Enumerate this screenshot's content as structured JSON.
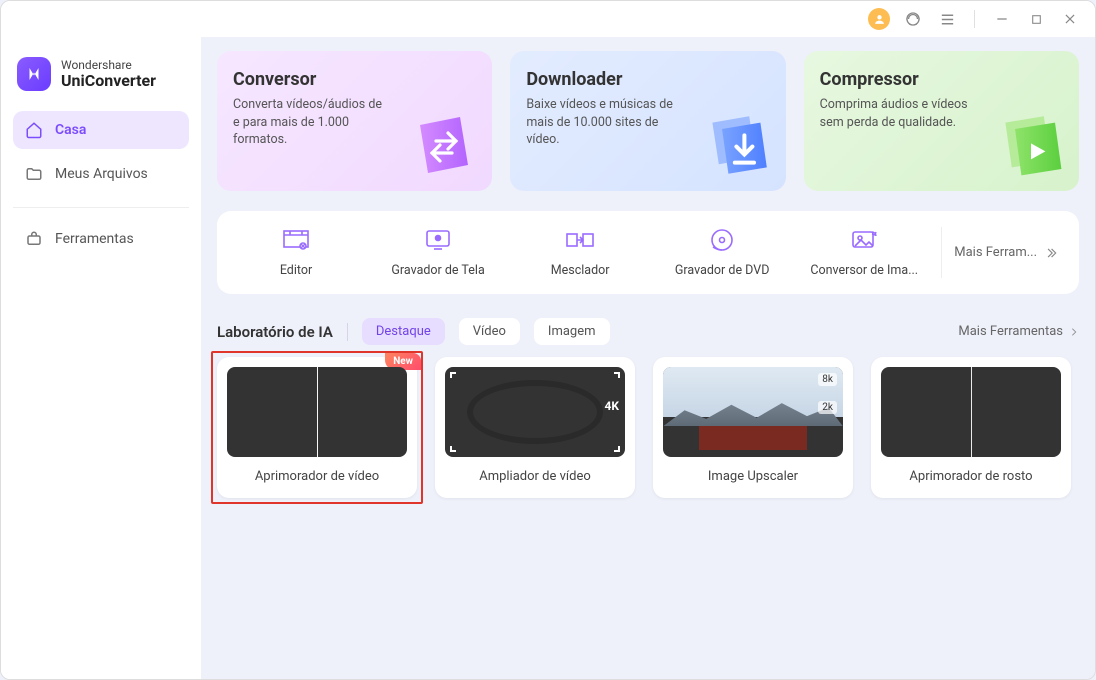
{
  "app": {
    "brand_small": "Wondershare",
    "brand_big": "UniConverter"
  },
  "sidebar": {
    "items": [
      {
        "label": "Casa"
      },
      {
        "label": "Meus Arquivos"
      },
      {
        "label": "Ferramentas"
      }
    ]
  },
  "cards": {
    "converter": {
      "title": "Conversor",
      "desc": "Converta vídeos/áudios de e para mais de 1.000 formatos."
    },
    "downloader": {
      "title": "Downloader",
      "desc": "Baixe vídeos e músicas de mais de 10.000 sites de vídeo."
    },
    "compressor": {
      "title": "Compressor",
      "desc": "Comprima áudios e vídeos sem perda de qualidade."
    }
  },
  "tools": {
    "items": [
      {
        "label": "Editor"
      },
      {
        "label": "Gravador de Tela"
      },
      {
        "label": "Mesclador"
      },
      {
        "label": "Gravador de DVD"
      },
      {
        "label": "Conversor de Ima..."
      }
    ],
    "more": "Mais Ferram..."
  },
  "lab": {
    "title": "Laboratório de IA",
    "tabs": [
      {
        "label": "Destaque"
      },
      {
        "label": "Vídeo"
      },
      {
        "label": "Imagem"
      }
    ],
    "more": "Mais Ferramentas",
    "cards": [
      {
        "label": "Aprimorador de vídeo",
        "badge": "New"
      },
      {
        "label": "Ampliador de vídeo",
        "tag": "4K"
      },
      {
        "label": "Image Upscaler",
        "tag8": "8k",
        "tag2": "2k"
      },
      {
        "label": "Aprimorador de rosto"
      }
    ]
  }
}
